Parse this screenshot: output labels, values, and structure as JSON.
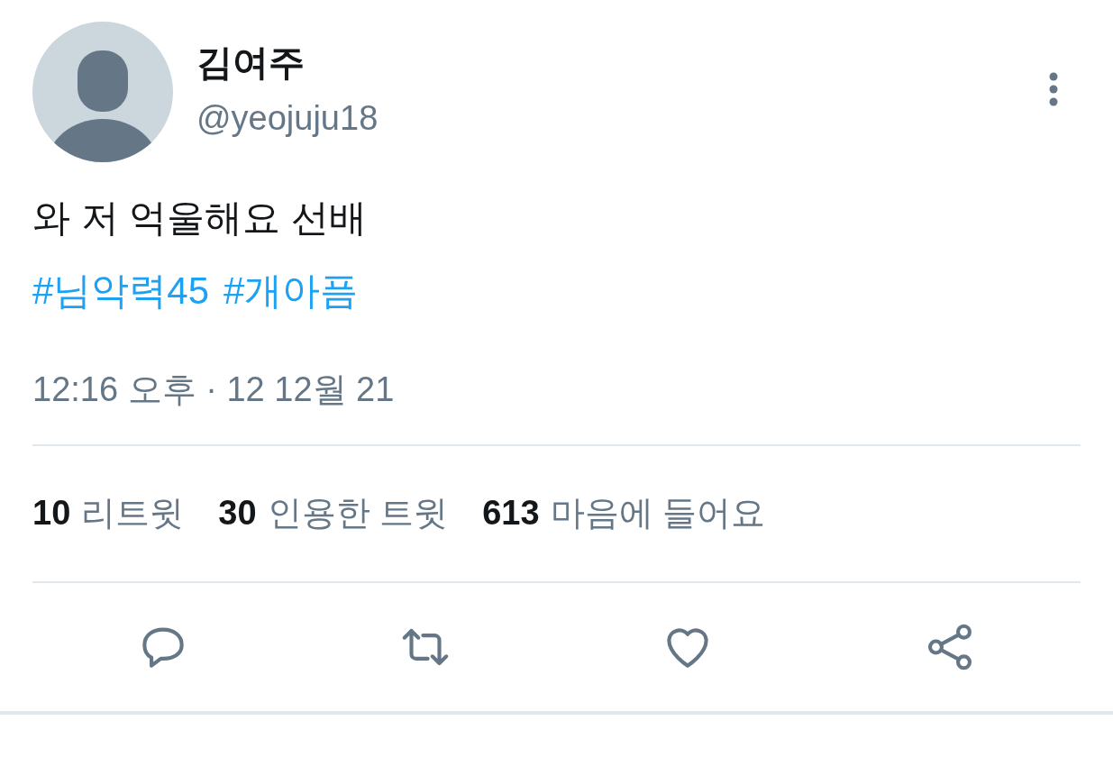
{
  "author": {
    "name": "김여주",
    "handle": "@yeojuju18"
  },
  "tweet": {
    "text": "와 저 억울해요 선배",
    "hashtags": [
      "#님악력45",
      "#개아픔"
    ]
  },
  "timestamp": "12:16 오후 · 12 12월 21",
  "stats": [
    {
      "count": "10",
      "label": "리트윗"
    },
    {
      "count": "30",
      "label": "인용한 트윗"
    },
    {
      "count": "613",
      "label": "마음에 들어요"
    }
  ],
  "actions": [
    {
      "kind": "reply"
    },
    {
      "kind": "retweet"
    },
    {
      "kind": "like"
    },
    {
      "kind": "share"
    }
  ]
}
